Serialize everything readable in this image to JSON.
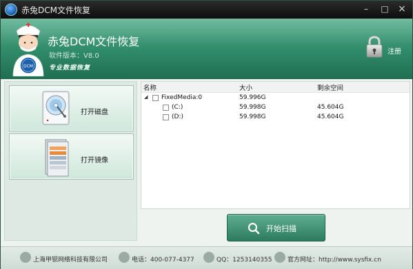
{
  "window": {
    "title": "赤兔DCM文件恢复",
    "minimize_label": "–",
    "maximize_label": "□",
    "close_label": "×"
  },
  "header": {
    "app_name": "赤兔DCM文件恢复",
    "version": "软件版本：V8.0",
    "slogan": "专业数据恢复",
    "register_label": "注册",
    "logo_text": "DCM"
  },
  "left_panel": {
    "open_disk_label": "打开磁盘",
    "open_image_label": "打开镜像"
  },
  "tree": {
    "columns": [
      "名称",
      "大小",
      "剩余空间"
    ],
    "rows": [
      {
        "name": "FixedMedia:0",
        "size": "59.996G",
        "free": ""
      },
      {
        "name": "(C:)",
        "size": "59.998G",
        "free": "45.604G"
      },
      {
        "name": "(D:)",
        "size": "59.998G",
        "free": "45.604G"
      }
    ]
  },
  "scan_button": {
    "label": "开始扫描"
  },
  "footer": {
    "company": "上海甲钡网络科技有限公司",
    "phone": "电话：400-077-4377",
    "qq": "QQ：1253140355",
    "website": "官方网址：http://www.sysfix.cn"
  },
  "colors": {
    "header_green": "#2f8a68",
    "scan_button_green": "#3f9373",
    "title_bar": "#111111"
  }
}
